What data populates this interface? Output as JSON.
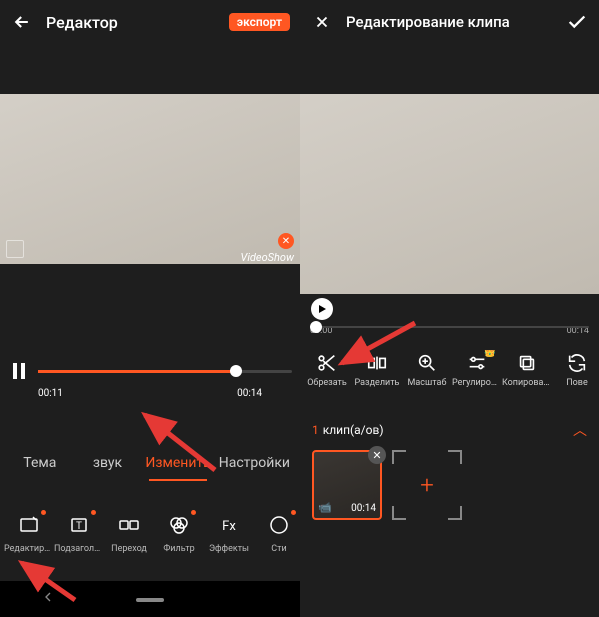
{
  "left": {
    "header": {
      "title": "Редактор",
      "export_label": "экспорт"
    },
    "watermark": "VideoShow",
    "timeline": {
      "current": "00:11",
      "total": "00:14"
    },
    "tabs": [
      "Тема",
      "звук",
      "Изменить",
      "Настройки"
    ],
    "active_tab_index": 2,
    "tools": [
      {
        "label": "Редактиров…",
        "icon": "edit-clip",
        "dot": true
      },
      {
        "label": "Подзаголов…",
        "icon": "text",
        "dot": true
      },
      {
        "label": "Переход",
        "icon": "transition",
        "dot": false
      },
      {
        "label": "Фильтр",
        "icon": "filter",
        "dot": true
      },
      {
        "label": "Эффекты",
        "icon": "fx",
        "dot": false
      },
      {
        "label": "Сти",
        "icon": "sticker",
        "dot": true
      }
    ]
  },
  "right": {
    "header": {
      "title": "Редактирование клипа"
    },
    "timeline": {
      "current": "00:00",
      "total": "00:14"
    },
    "tools": [
      {
        "label": "Обрезать",
        "icon": "scissors"
      },
      {
        "label": "Разделить",
        "icon": "split"
      },
      {
        "label": "Масштаб",
        "icon": "zoom"
      },
      {
        "label": "Регулировка",
        "icon": "adjust",
        "crown": true
      },
      {
        "label": "Копировать",
        "icon": "copy"
      },
      {
        "label": "Пове",
        "icon": "rotate"
      }
    ],
    "clip_header": {
      "count": "1",
      "label": "клип(а/ов)"
    },
    "clip": {
      "duration": "00:14"
    }
  }
}
